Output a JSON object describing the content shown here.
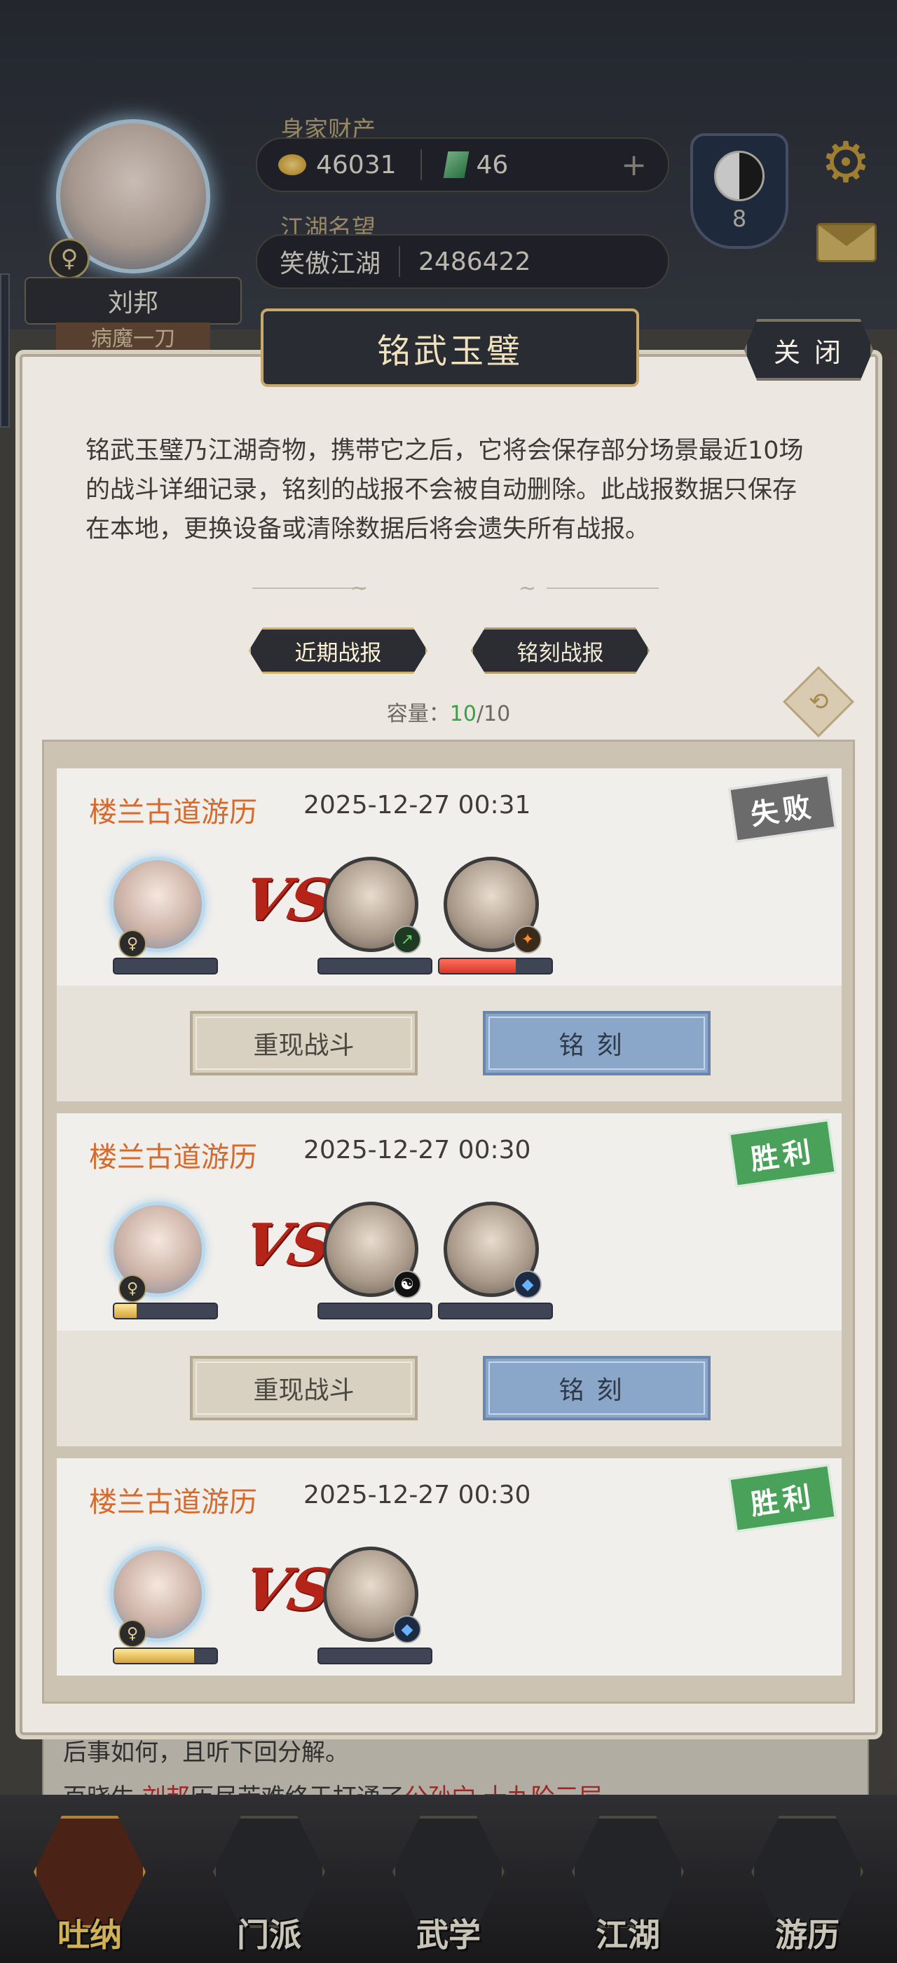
{
  "header": {
    "wealth_label": "身家财产",
    "gold": "46031",
    "jade": "46",
    "plus_glyph": "+",
    "reputation_label": "江湖名望",
    "reputation_title": "笑傲江湖",
    "reputation_value": "2486422",
    "player_name": "刘邦",
    "player_title": "病魔一刀",
    "gender_glyph": "♀",
    "level": "8"
  },
  "modal": {
    "title": "铭武玉璧",
    "close_label": "关 闭",
    "description": "铭武玉璧乃江湖奇物，携带它之后，它将会保存部分场景最近10场的战斗详细记录，铭刻的战报不会被自动删除。此战报数据只保存在本地，更换设备或清除数据后将会遗失所有战报。",
    "tabs": [
      {
        "label": "近期战报"
      },
      {
        "label": "铭刻战报"
      }
    ],
    "capacity_label": "容量：",
    "capacity_used": "10",
    "capacity_total": "/10"
  },
  "records": [
    {
      "location": "楼兰古道游历",
      "time": "2025-12-27 00:31",
      "result": "失败",
      "player_hp": 0.0,
      "enemies": [
        {
          "badge": "green",
          "hp": 0.0
        },
        {
          "badge": "orange",
          "hp": 0.68
        }
      ],
      "replay_label": "重现战斗",
      "engrave_label": "铭刻"
    },
    {
      "location": "楼兰古道游历",
      "time": "2025-12-27 00:30",
      "result": "胜利",
      "player_hp": 0.22,
      "enemies": [
        {
          "badge": "taiji",
          "hp": 0.0
        },
        {
          "badge": "blue",
          "hp": 0.0
        }
      ],
      "replay_label": "重现战斗",
      "engrave_label": "铭刻"
    },
    {
      "location": "楼兰古道游历",
      "time": "2025-12-27 00:30",
      "result": "胜利",
      "player_hp": 0.78,
      "enemies": [
        {
          "badge": "blue",
          "hp": 0.0
        }
      ]
    }
  ],
  "vs_label": "VS",
  "underlay": {
    "line1": "后事如何，且听下回分解。",
    "line2_prefix": "百晓生·",
    "line2_name": "刘邦",
    "line2_mid": "历尽苦难终于打通了",
    "line2_skill": "公孙穴·十九阶三层"
  },
  "bottom_nav": [
    {
      "label": "吐纳",
      "active": true
    },
    {
      "label": "门派",
      "active": false
    },
    {
      "label": "武学",
      "active": false
    },
    {
      "label": "江湖",
      "active": false
    },
    {
      "label": "游历",
      "active": false
    }
  ],
  "colors": {
    "lose_stamp": "#6b6b6b",
    "win_stamp": "#4aa25a",
    "location_text": "#d56a2c",
    "engrave_button": "#8aa6c9"
  }
}
